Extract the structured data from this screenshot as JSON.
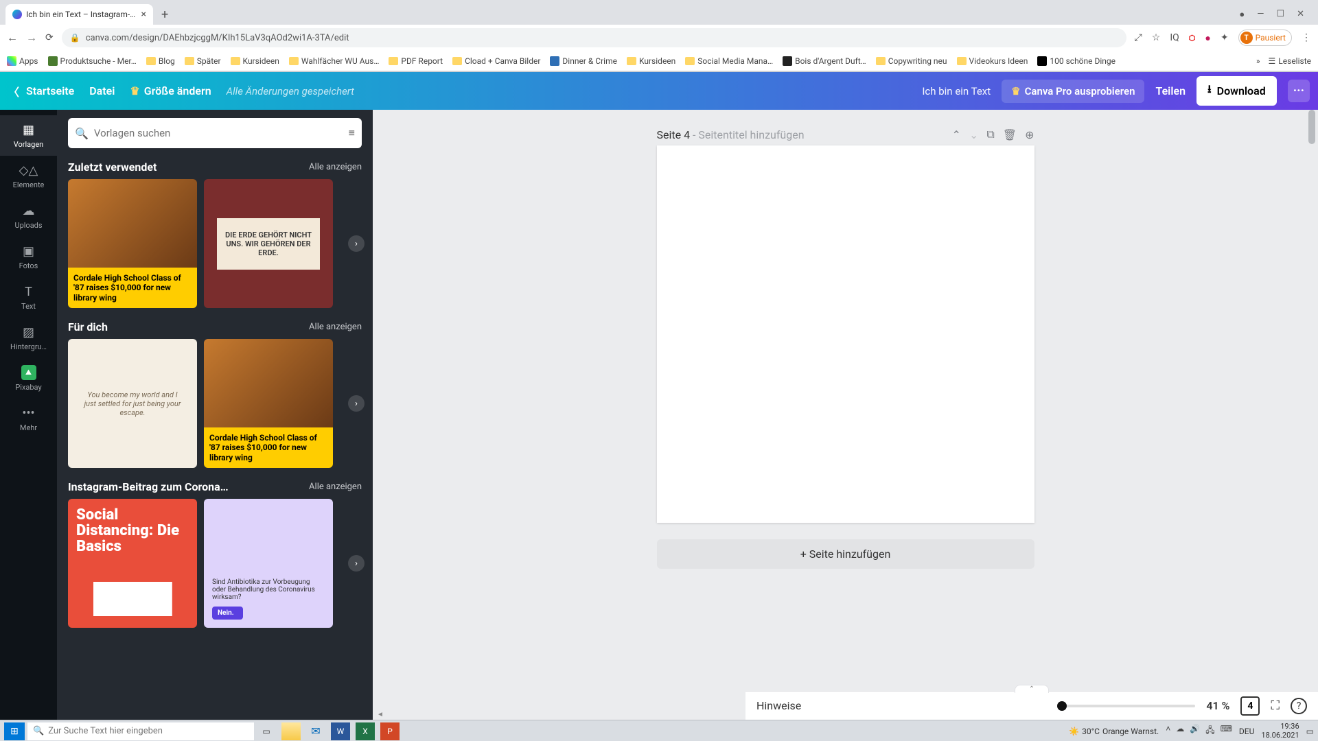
{
  "browser": {
    "tab_title": "Ich bin ein Text – Instagram-Beit…",
    "url": "canva.com/design/DAEhbzjcggM/KIh15LaV3qAOd2wi1A-3TA/edit",
    "paused_label": "Pausiert",
    "avatar_initial": "T",
    "bookmarks": {
      "apps": "Apps",
      "items": [
        "Produktsuche - Mer…",
        "Blog",
        "Später",
        "Kursideen",
        "Wahlfächer WU Aus…",
        "PDF Report",
        "Cload + Canva Bilder",
        "Dinner & Crime",
        "Kursideen",
        "Social Media Mana…",
        "Bois d'Argent Duft…",
        "Copywriting neu",
        "Videokurs Ideen",
        "100 schöne Dinge"
      ],
      "reading_list": "Leseliste"
    }
  },
  "header": {
    "home": "Startseite",
    "file": "Datei",
    "resize": "Größe ändern",
    "save_status": "Alle Änderungen gespeichert",
    "doc_title": "Ich bin ein Text",
    "try_pro": "Canva Pro ausprobieren",
    "share": "Teilen",
    "download": "Download"
  },
  "rail": {
    "templates": "Vorlagen",
    "elements": "Elemente",
    "uploads": "Uploads",
    "photos": "Fotos",
    "text": "Text",
    "background": "Hintergru…",
    "pixabay": "Pixabay",
    "more": "Mehr"
  },
  "panel": {
    "search_placeholder": "Vorlagen suchen",
    "see_all": "Alle anzeigen",
    "sections": {
      "recent": "Zuletzt verwendet",
      "for_you": "Für dich",
      "corona": "Instagram-Beitrag zum Corona…"
    },
    "thumbs": {
      "news_caption": "Cordale High School Class of '87 raises $10,000 for new library wing",
      "earth_caption": "DIE ERDE GEHÖRT NICHT UNS. WIR GEHÖREN DER ERDE.",
      "feather_caption": "You become my world and I just settled for just being your escape.",
      "social_title": "Social Distancing: Die Basics",
      "antibio_q": "Sind Antibiotika zur Vorbeugung oder Behandlung des Coronavirus wirksam?",
      "antibio_tag": "Nein."
    }
  },
  "canvas": {
    "page_prefix": "Seite 4",
    "page_sep": " - ",
    "page_title_placeholder": "Seitentitel hinzufügen",
    "add_page": "+ Seite hinzufügen"
  },
  "bottom": {
    "notes": "Hinweise",
    "zoom_pct": "41 %",
    "page_count": "4"
  },
  "taskbar": {
    "search_placeholder": "Zur Suche Text hier eingeben",
    "weather_temp": "30°C",
    "weather_text": "Orange Warnst.",
    "lang": "DEU",
    "time": "19:36",
    "date": "18.06.2021"
  }
}
